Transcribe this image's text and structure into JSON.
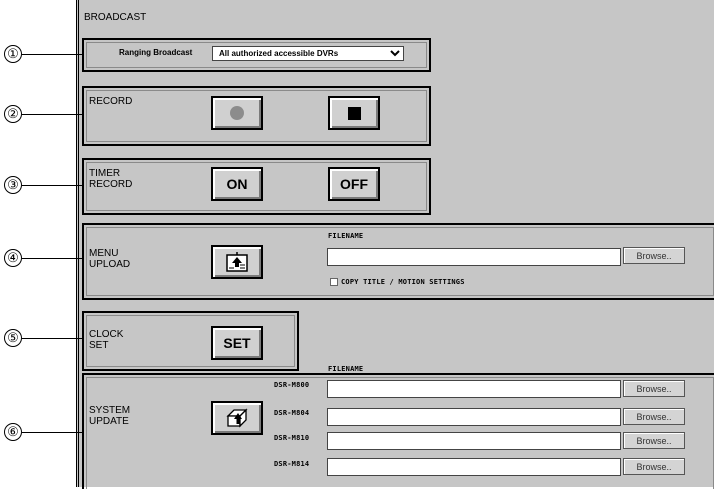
{
  "page_title": "BROADCAST",
  "callouts": [
    "①",
    "②",
    "③",
    "④",
    "⑤",
    "⑥"
  ],
  "broadcast": {
    "label": "Ranging Broadcast",
    "selected": "All authorized accessible DVRs",
    "options": [
      "All authorized accessible DVRs"
    ]
  },
  "record": {
    "label": "RECORD",
    "start_icon": "record-circle-icon",
    "stop_icon": "stop-square-icon"
  },
  "timer": {
    "label_line1": "TIMER",
    "label_line2": "RECORD",
    "on_label": "ON",
    "off_label": "OFF"
  },
  "menu_upload": {
    "label_line1": "MENU",
    "label_line2": "UPLOAD",
    "filename_header": "FILENAME",
    "filename_value": "",
    "browse_label": "Browse..",
    "copy_label": "COPY TITLE / MOTION SETTINGS"
  },
  "clock": {
    "label_line1": "CLOCK",
    "label_line2": "SET",
    "set_label": "SET"
  },
  "system_update": {
    "label_line1": "SYSTEM",
    "label_line2": "UPDATE",
    "filename_header": "FILENAME",
    "rows": [
      {
        "model": "DSR-M800",
        "value": "",
        "browse": "Browse.."
      },
      {
        "model": "DSR-M804",
        "value": "",
        "browse": "Browse.."
      },
      {
        "model": "DSR-M810",
        "value": "",
        "browse": "Browse.."
      },
      {
        "model": "DSR-M814",
        "value": "",
        "browse": "Browse.."
      }
    ]
  }
}
